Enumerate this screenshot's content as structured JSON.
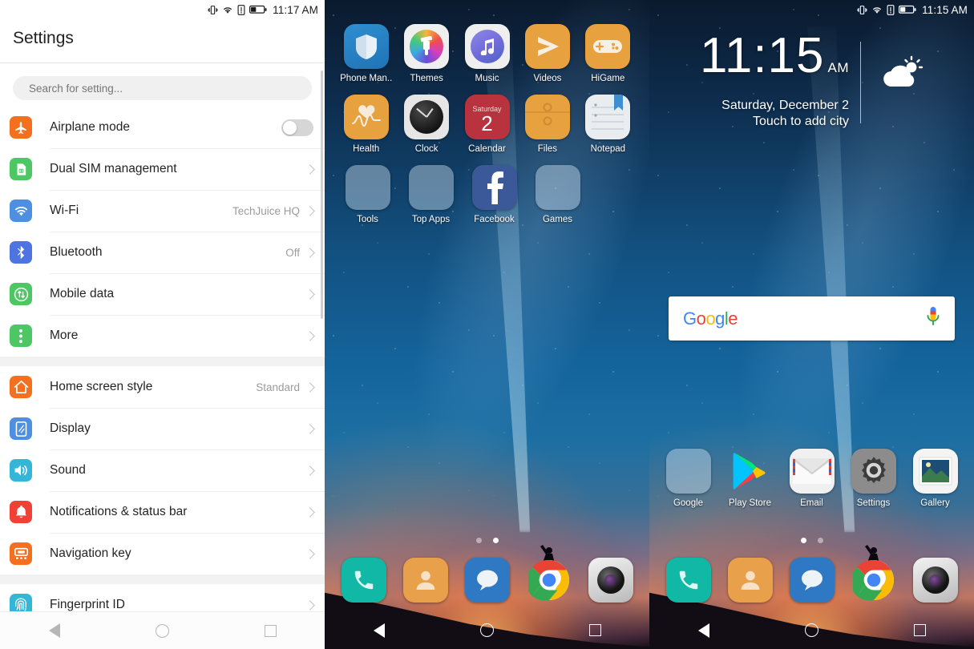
{
  "status_bars": {
    "left": {
      "time": "11:17 AM",
      "icons": [
        "vibrate-icon",
        "wifi-icon",
        "sim-alert-icon",
        "battery-icon"
      ]
    },
    "right": {
      "time": "11:15 AM",
      "icons": [
        "vibrate-icon",
        "wifi-icon",
        "sim-alert-icon",
        "battery-icon"
      ]
    }
  },
  "settings": {
    "title": "Settings",
    "search_placeholder": "Search for setting...",
    "groups": [
      {
        "rows": [
          {
            "label": "Airplane mode",
            "value": "",
            "icon": "airplane-icon",
            "color": "#F4701F",
            "control": "toggle",
            "toggle_on": false
          },
          {
            "label": "Dual SIM management",
            "value": "",
            "icon": "sim-card-icon",
            "color": "#4CC764",
            "control": "chevron"
          },
          {
            "label": "Wi-Fi",
            "value": "TechJuice HQ",
            "icon": "wifi-icon",
            "color": "#4D8FE0",
            "control": "chevron"
          },
          {
            "label": "Bluetooth",
            "value": "Off",
            "icon": "bluetooth-icon",
            "color": "#4D74E0",
            "control": "chevron"
          },
          {
            "label": "Mobile data",
            "value": "",
            "icon": "mobile-data-icon",
            "color": "#4CC764",
            "control": "chevron"
          },
          {
            "label": "More",
            "value": "",
            "icon": "more-dots-icon",
            "color": "#4CC764",
            "control": "chevron"
          }
        ]
      },
      {
        "rows": [
          {
            "label": "Home screen style",
            "value": "Standard",
            "icon": "home-icon",
            "color": "#F4701F",
            "control": "chevron"
          },
          {
            "label": "Display",
            "value": "",
            "icon": "display-icon",
            "color": "#4D8FE0",
            "control": "chevron"
          },
          {
            "label": "Sound",
            "value": "",
            "icon": "sound-icon",
            "color": "#35B6D8",
            "control": "chevron"
          },
          {
            "label": "Notifications & status bar",
            "value": "",
            "icon": "bell-icon",
            "color": "#EF4136",
            "control": "chevron"
          },
          {
            "label": "Navigation key",
            "value": "",
            "icon": "navigation-key-icon",
            "color": "#F4701F",
            "control": "chevron"
          }
        ]
      },
      {
        "rows": [
          {
            "label": "Fingerprint ID",
            "value": "",
            "icon": "fingerprint-icon",
            "color": "#35B6D8",
            "control": "chevron"
          }
        ]
      }
    ]
  },
  "home_page_apps": {
    "rows": [
      [
        {
          "label": "Phone Man..",
          "icon": "shield-icon"
        },
        {
          "label": "Themes",
          "icon": "paintbrush-icon"
        },
        {
          "label": "Music",
          "icon": "music-note-icon"
        },
        {
          "label": "Videos",
          "icon": "video-play-icon"
        },
        {
          "label": "HiGame",
          "icon": "gamepad-icon"
        }
      ],
      [
        {
          "label": "Health",
          "icon": "heart-pulse-icon"
        },
        {
          "label": "Clock",
          "icon": "analog-clock-icon"
        },
        {
          "label": "Calendar",
          "icon": "calendar-icon",
          "day_name": "Saturday",
          "day_number": "2"
        },
        {
          "label": "Files",
          "icon": "file-folder-icon"
        },
        {
          "label": "Notepad",
          "icon": "notepad-icon"
        }
      ],
      [
        {
          "label": "Tools",
          "icon": "folder-icon"
        },
        {
          "label": "Top Apps",
          "icon": "folder-icon"
        },
        {
          "label": "Facebook",
          "icon": "facebook-icon"
        },
        {
          "label": "Games",
          "icon": "folder-icon"
        }
      ]
    ],
    "page_dots": {
      "count": 2,
      "active": 1
    }
  },
  "home_page_main": {
    "clock_widget": {
      "time": "11:15",
      "ampm": "AM",
      "date": "Saturday, December 2",
      "subtitle": "Touch to add city",
      "weather_icon": "sun-behind-cloud-icon"
    },
    "google_bar": {
      "logo_letters": [
        "G",
        "o",
        "o",
        "g",
        "l",
        "e"
      ],
      "mic_icon": "microphone-icon"
    },
    "apps": [
      {
        "label": "Google",
        "icon": "folder-icon"
      },
      {
        "label": "Play Store",
        "icon": "play-store-icon"
      },
      {
        "label": "Email",
        "icon": "envelope-icon"
      },
      {
        "label": "Settings",
        "icon": "gear-icon"
      },
      {
        "label": "Gallery",
        "icon": "photo-icon"
      }
    ],
    "page_dots": {
      "count": 2,
      "active": 0
    }
  },
  "dock": [
    {
      "name": "phone-icon",
      "color": "#11B8A6"
    },
    {
      "name": "contacts-icon",
      "color": "#E9A04A"
    },
    {
      "name": "messages-icon",
      "color": "#2E78C4"
    },
    {
      "name": "chrome-icon",
      "color": "#ffffff"
    },
    {
      "name": "camera-icon",
      "color": "#cfcfcf"
    }
  ],
  "navbar": {
    "back": "back-triangle-icon",
    "home": "home-circle-icon",
    "recents": "recents-square-icon"
  },
  "colors": {
    "accent_orange": "#F4701F",
    "accent_green": "#4CC764",
    "accent_blue": "#4D8FE0",
    "wallpaper_blue": "#12507f"
  }
}
